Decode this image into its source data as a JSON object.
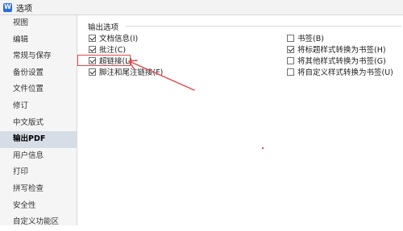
{
  "window": {
    "title": "选项",
    "app_icon_letter": "W"
  },
  "sidebar": {
    "items": [
      {
        "label": "视图"
      },
      {
        "label": "编辑"
      },
      {
        "label": "常规与保存"
      },
      {
        "label": "备份设置"
      },
      {
        "label": "文件位置"
      },
      {
        "label": "修订"
      },
      {
        "label": "中文版式"
      },
      {
        "label": "输出PDF",
        "active": true
      },
      {
        "label": "用户信息"
      },
      {
        "label": "打印"
      },
      {
        "label": "拼写检查"
      },
      {
        "label": "安全性"
      },
      {
        "label": "自定义功能区"
      }
    ]
  },
  "output_options": {
    "group_label": "输出选项",
    "left": [
      {
        "label": "文档信息(I)",
        "checked": true
      },
      {
        "label": "批注(C)",
        "checked": true
      },
      {
        "label": "超链接(L)",
        "checked": true
      },
      {
        "label": "脚注和尾注链接(F)",
        "checked": true
      }
    ],
    "right": [
      {
        "label": "书签(B)",
        "checked": false
      },
      {
        "label": "将标题样式转换为书签(H)",
        "checked": true
      },
      {
        "label": "将其他样式转换为书签(G)",
        "checked": false
      },
      {
        "label": "将自定义样式转换为书签(U)",
        "checked": false
      }
    ]
  },
  "annotation": {
    "color": "#e0484a"
  }
}
